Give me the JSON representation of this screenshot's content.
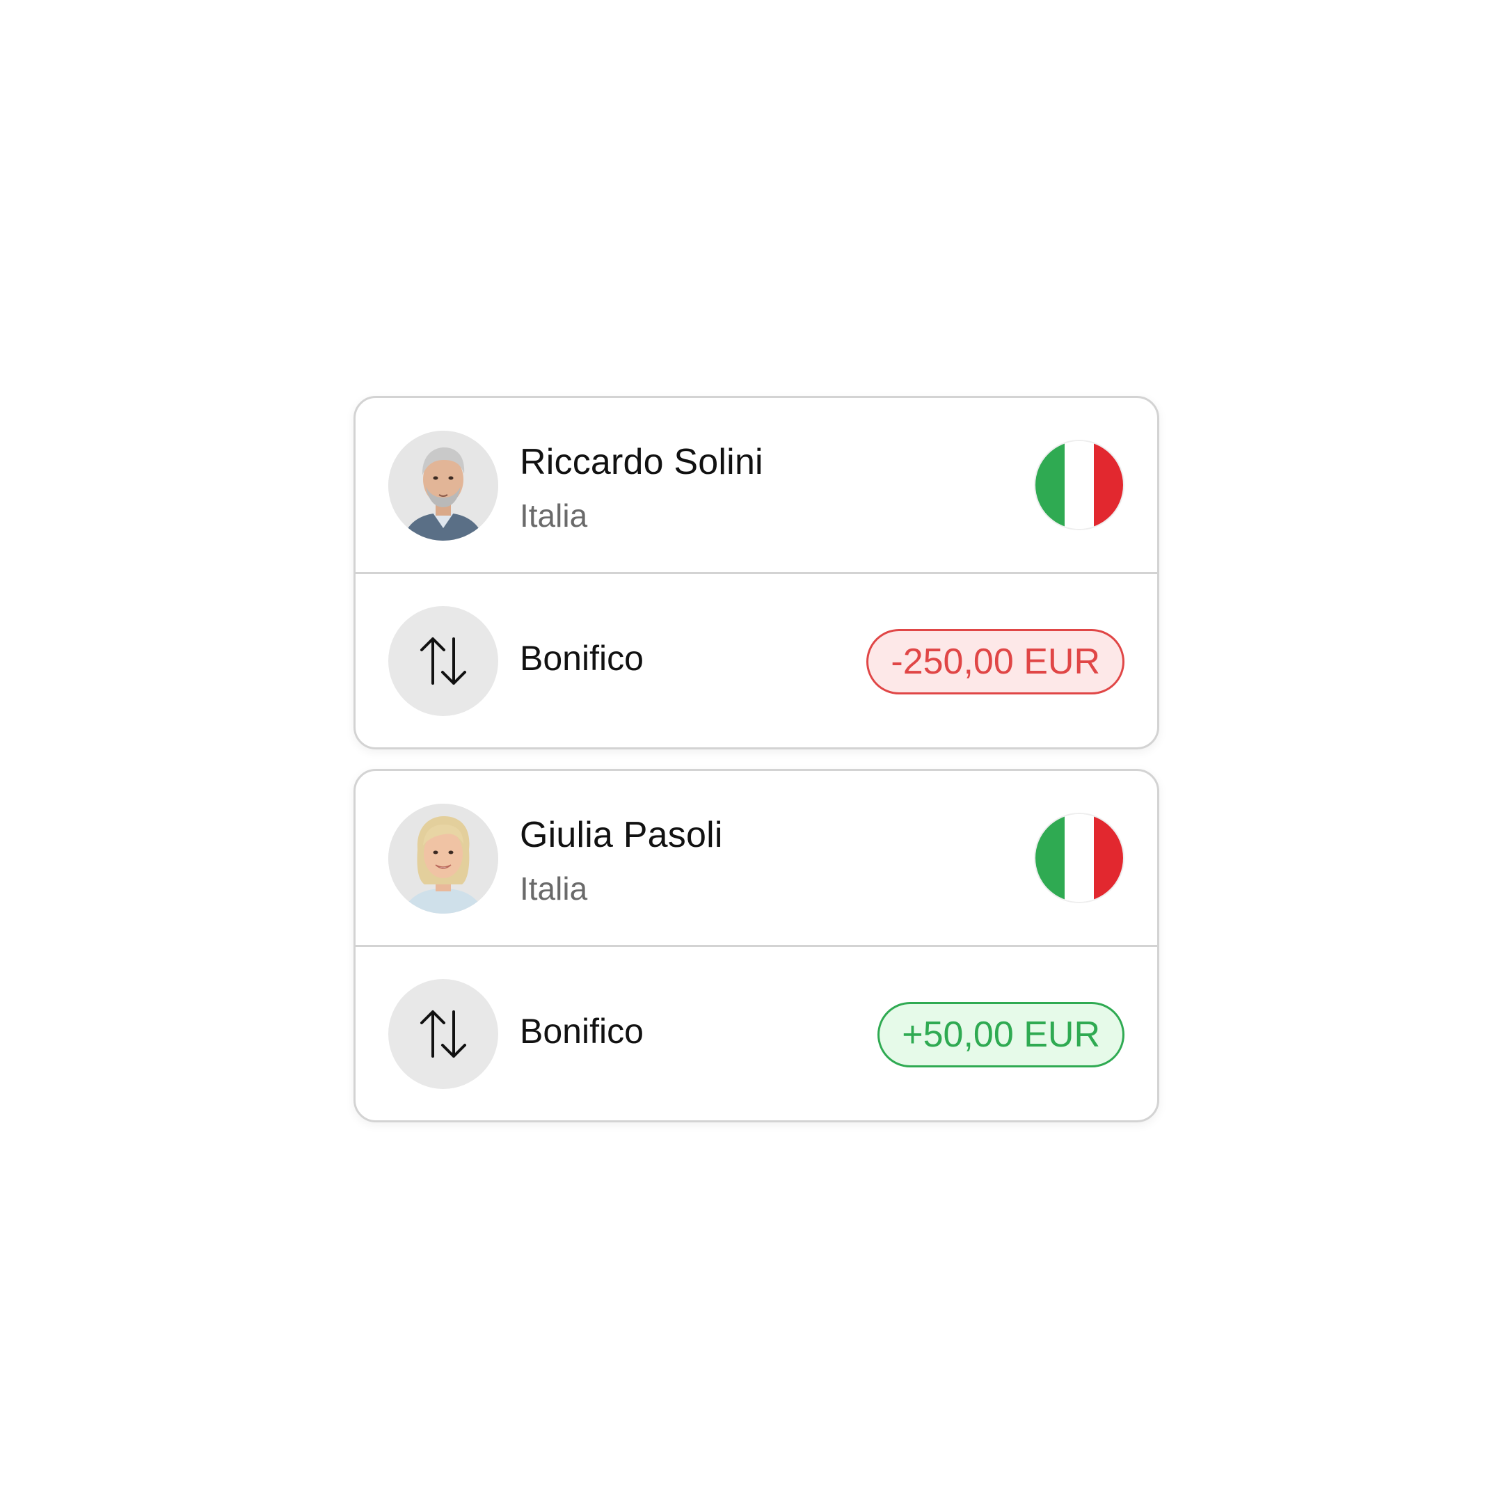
{
  "transactions": [
    {
      "name": "Riccardo Solini",
      "country": "Italia",
      "avatar": "avatar-man-photo",
      "flag": {
        "icon": "italy-flag-icon",
        "colors": [
          "#2faa52",
          "#ffffff",
          "#e2282f"
        ]
      },
      "method": "Bonifico",
      "method_icon": "transfer-arrows-icon",
      "amount": "-250,00 EUR",
      "amount_type": "negative",
      "amount_color": "#e04646"
    },
    {
      "name": "Giulia Pasoli",
      "country": "Italia",
      "avatar": "avatar-woman-photo",
      "flag": {
        "icon": "italy-flag-icon",
        "colors": [
          "#2faa52",
          "#ffffff",
          "#e2282f"
        ]
      },
      "method": "Bonifico",
      "method_icon": "transfer-arrows-icon",
      "amount": "+50,00 EUR",
      "amount_type": "positive",
      "amount_color": "#2faa52"
    }
  ]
}
